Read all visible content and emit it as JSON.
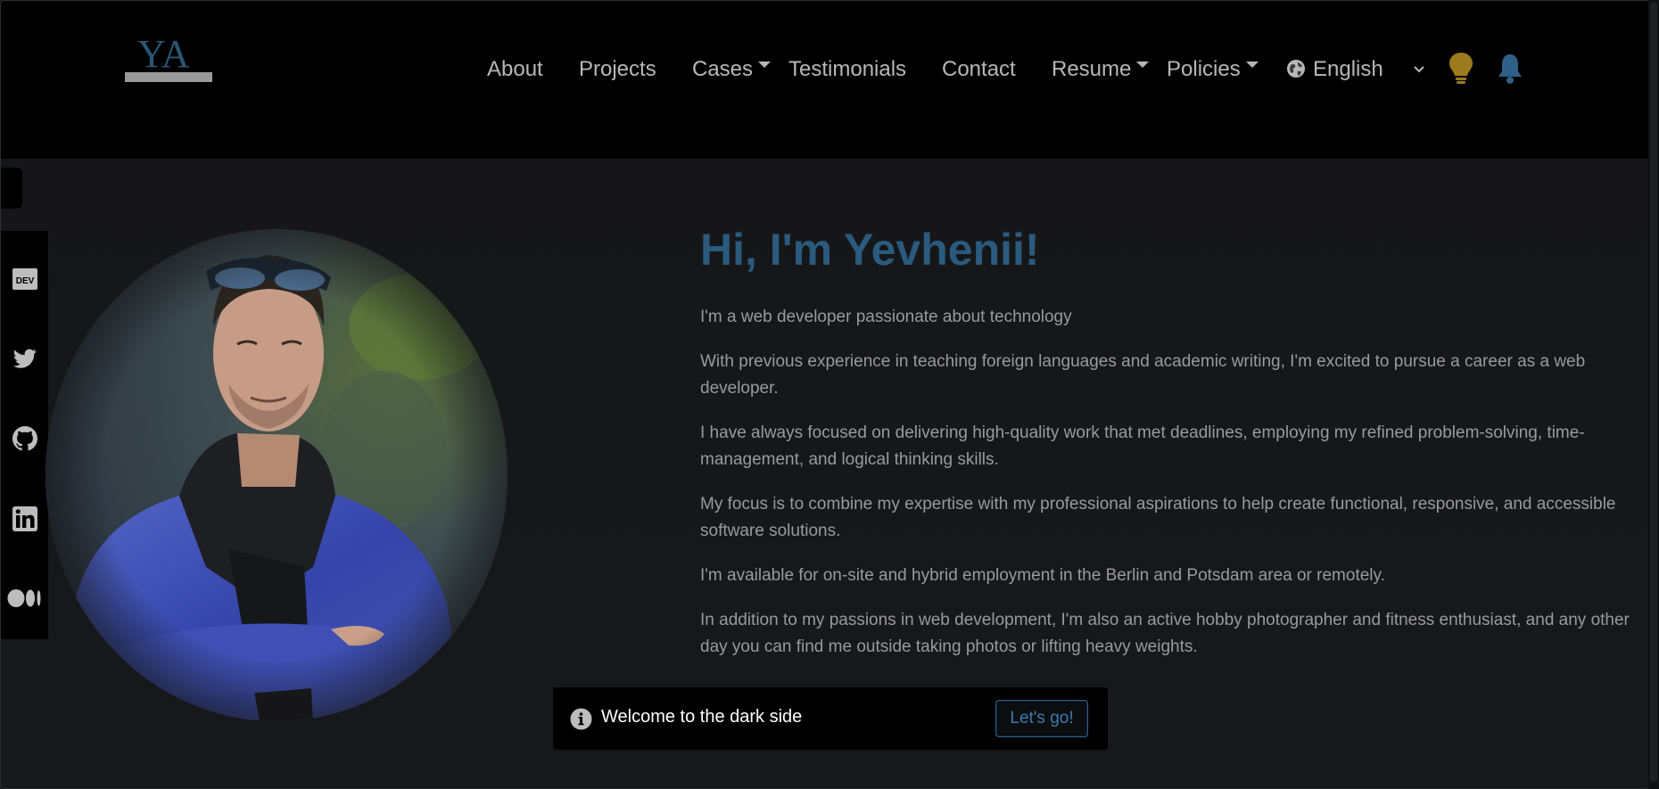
{
  "brand": {
    "logo_text": "YA"
  },
  "nav": {
    "about": "About",
    "projects": "Projects",
    "cases": "Cases",
    "testimonials": "Testimonials",
    "contact": "Contact",
    "resume": "Resume",
    "policies": "Policies",
    "language": "English"
  },
  "header_icons": [
    "globe-icon",
    "chevron-down-icon",
    "lightbulb-icon",
    "bell-icon"
  ],
  "social": [
    {
      "name": "dev-icon",
      "label": "DEV"
    },
    {
      "name": "twitter-icon"
    },
    {
      "name": "github-icon"
    },
    {
      "name": "linkedin-icon"
    },
    {
      "name": "medium-icon"
    }
  ],
  "hero": {
    "title": "Hi, I'm Yevhenii!",
    "paragraphs": [
      "I'm a web developer passionate about technology",
      "With previous experience in teaching foreign languages and academic writing, I'm excited to pursue a career as a web developer.",
      "I have always focused on delivering high-quality work that met deadlines, employing my refined problem-solving, time-management, and logical thinking skills.",
      "My focus is to combine my expertise with my professional aspirations to help create functional, responsive, and accessible software solutions.",
      "I'm available for on-site and hybrid employment in the Berlin and Potsdam area or remotely.",
      "In addition to my passions in web development, I'm also an active hobby photographer and fitness enthusiast, and any other day you can find me outside taking photos or lifting heavy weights."
    ]
  },
  "toast": {
    "message": "Welcome to the dark side",
    "button": "Let's go!"
  },
  "colors": {
    "accent": "#2a5a7e",
    "bulb": "#9c7a1e",
    "bell": "#2d5f88",
    "background": "#151617",
    "header": "#000000"
  }
}
